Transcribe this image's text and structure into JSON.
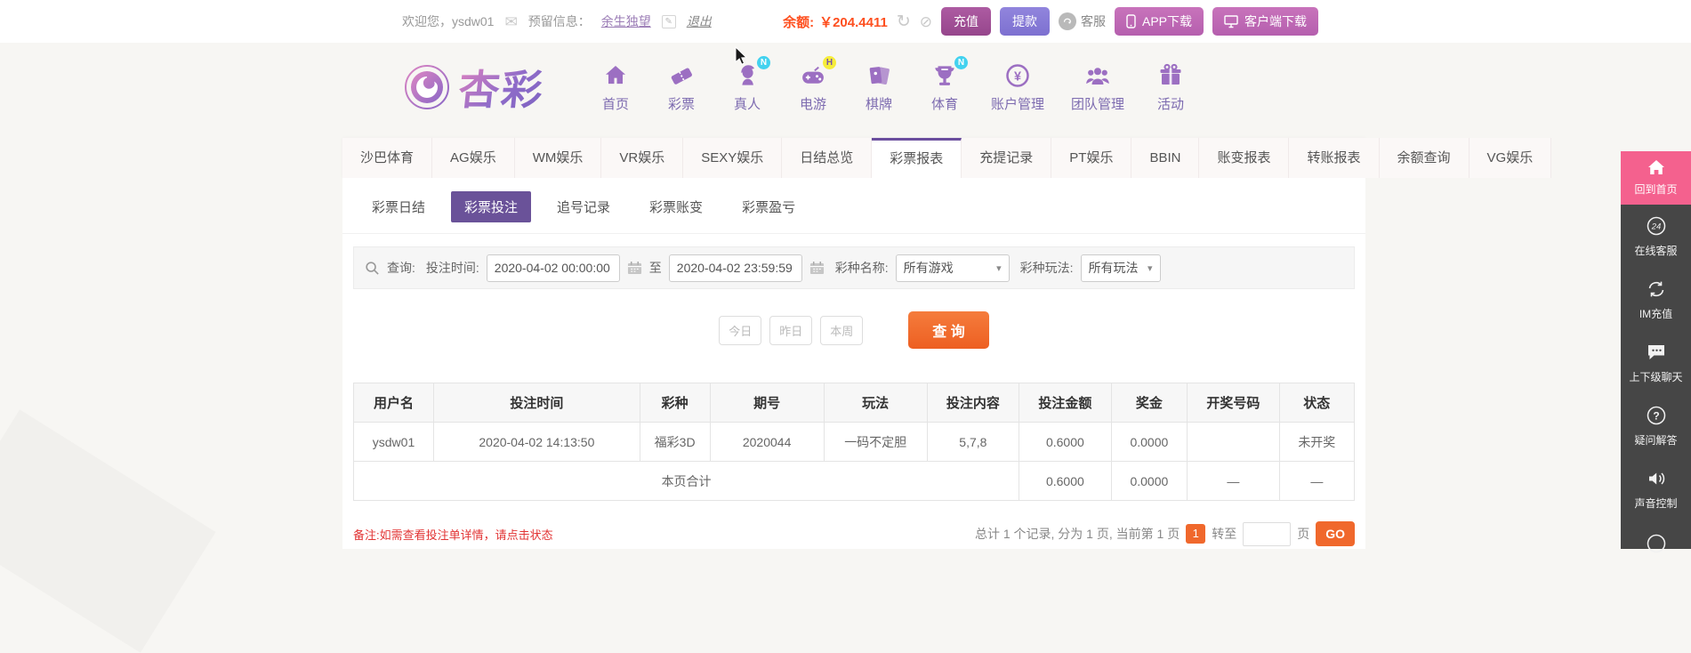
{
  "colors": {
    "brand_purple": "#6b4e9e",
    "subtab_purple": "#6a5299",
    "accent_orange": "#f0682c",
    "balance_red": "#fe4f1f",
    "note_red": "#e23434",
    "status_green": "#3f9e4d",
    "rail_pink": "#f4618e",
    "deposit_magenta": "#96468c",
    "withdraw_violet": "#7d70d0",
    "download_pink": "#b55fae"
  },
  "icons": {
    "mail": "✉",
    "edit": "✎",
    "refresh": "↻",
    "eye_off": "⊘",
    "chevron_down": "▾"
  },
  "topbar": {
    "welcome": "欢迎您，ysdw01",
    "reserved_label": "预留信息：",
    "reserved_value": "余生独望",
    "logout": "退出",
    "balance_label": "余额:",
    "balance_value": "￥204.4411",
    "deposit": "充值",
    "withdraw": "提款",
    "service": "客服",
    "app_download": "APP下载",
    "client_download": "客户端下载"
  },
  "brand": {
    "logo_text": "杏彩"
  },
  "nav": {
    "items": [
      {
        "label": "首页",
        "icon": "home-icon",
        "badge": ""
      },
      {
        "label": "彩票",
        "icon": "ticket-icon",
        "badge": ""
      },
      {
        "label": "真人",
        "icon": "live-person-icon",
        "badge": "N"
      },
      {
        "label": "电游",
        "icon": "gamepad-icon",
        "badge": "H"
      },
      {
        "label": "棋牌",
        "icon": "cards-icon",
        "badge": ""
      },
      {
        "label": "体育",
        "icon": "trophy-icon",
        "badge": "N"
      },
      {
        "label": "账户管理",
        "icon": "coin-icon",
        "badge": ""
      },
      {
        "label": "团队管理",
        "icon": "team-icon",
        "badge": ""
      },
      {
        "label": "活动",
        "icon": "gift-icon",
        "badge": ""
      }
    ]
  },
  "tabs": [
    "沙巴体育",
    "AG娱乐",
    "WM娱乐",
    "VR娱乐",
    "SEXY娱乐",
    "日结总览",
    "彩票报表",
    "充提记录",
    "PT娱乐",
    "BBIN",
    "账变报表",
    "转账报表",
    "余额查询",
    "VG娱乐"
  ],
  "subtabs": [
    "彩票日结",
    "彩票投注",
    "追号记录",
    "彩票账变",
    "彩票盈亏"
  ],
  "query": {
    "label": "查询:",
    "time_label": "投注时间:",
    "time_from": "2020-04-02 00:00:00",
    "to_label": "至",
    "time_to": "2020-04-02 23:59:59",
    "lottery_label": "彩种名称:",
    "lottery_value": "所有游戏",
    "play_label": "彩种玩法:",
    "play_value": "所有玩法"
  },
  "actions": {
    "today": "今日",
    "yesterday": "昨日",
    "this_week": "本周",
    "search": "查 询"
  },
  "table": {
    "headers": [
      "用户名",
      "投注时间",
      "彩种",
      "期号",
      "玩法",
      "投注内容",
      "投注金额",
      "奖金",
      "开奖号码",
      "状态"
    ],
    "rows": [
      [
        "ysdw01",
        "2020-04-02 14:13:50",
        "福彩3D",
        "2020044",
        "一码不定胆",
        "5,7,8",
        "0.6000",
        "0.0000",
        "",
        "未开奖"
      ]
    ],
    "summary": {
      "label": "本页合计",
      "amount": "0.6000",
      "prize": "0.0000",
      "dash1": "—",
      "dash2": "—"
    }
  },
  "footer": {
    "note": "备注:如需查看投注单详情，请点击状态",
    "pagination_text": "总计 1 个记录, 分为 1 页, 当前第 1 页",
    "current_page": "1",
    "goto_label": "转至",
    "page_label": "页",
    "go": "GO"
  },
  "rail": {
    "home": "回到首页",
    "service_badge": "24",
    "items": [
      {
        "label": "在线客服",
        "icon": "service-24-icon"
      },
      {
        "label": "IM充值",
        "icon": "im-recharge-icon"
      },
      {
        "label": "上下级聊天",
        "icon": "chat-icon"
      },
      {
        "label": "疑问解答",
        "icon": "faq-icon"
      },
      {
        "label": "声音控制",
        "icon": "sound-icon"
      }
    ]
  }
}
